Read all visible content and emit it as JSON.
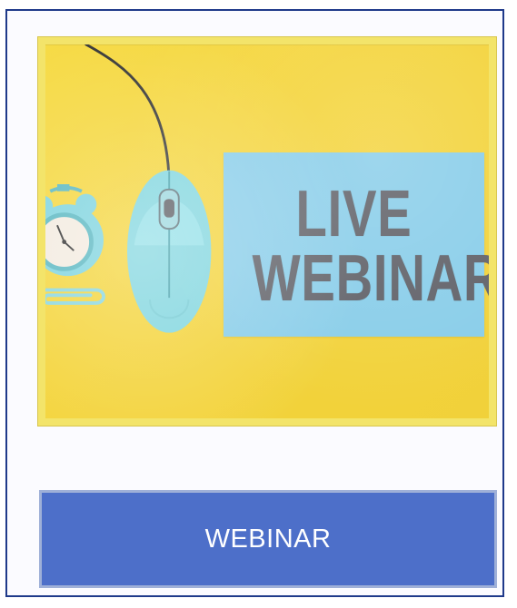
{
  "card": {
    "image": {
      "sticky_note": {
        "line1": "LIVE",
        "line2": "WEBINAR!"
      },
      "icons": {
        "clock": "alarm-clock-icon",
        "mouse": "mouse-icon",
        "paperclip": "paperclip-icon"
      }
    },
    "cta": {
      "label": "WEBINAR"
    }
  }
}
